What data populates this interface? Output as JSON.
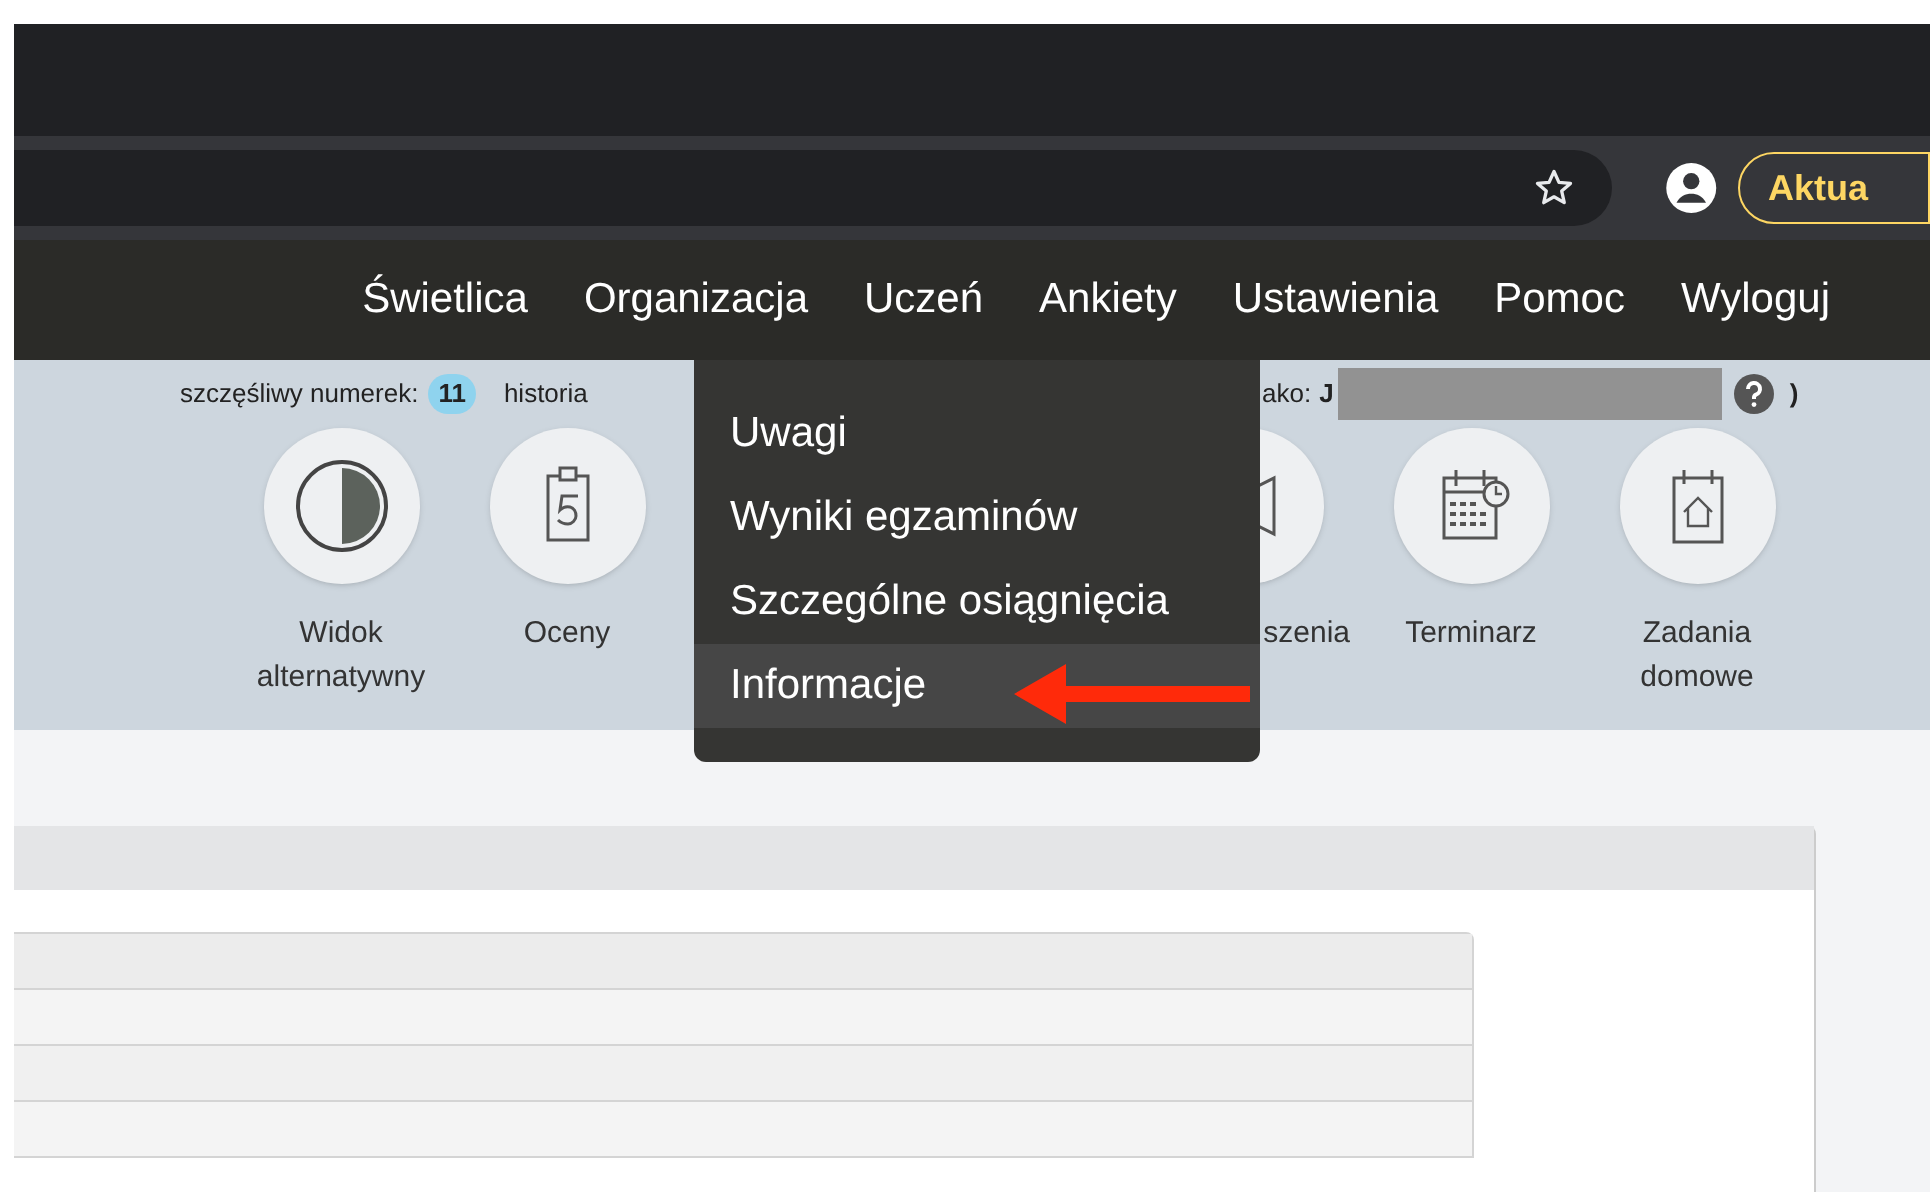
{
  "browser": {
    "profile_button": "Aktua"
  },
  "nav": {
    "items": [
      "Świetlica",
      "Organizacja",
      "Uczeń",
      "Ankiety",
      "Ustawienia",
      "Pomoc",
      "Wyloguj"
    ]
  },
  "info_bar": {
    "lucky_label": "szczęśliwy numerek:",
    "lucky_number": "11",
    "login_history": "historia",
    "logged_as": "ako:",
    "user": "J",
    "close_paren": ")"
  },
  "tiles": [
    {
      "kind": "contrast",
      "label": "Widok alternatywny"
    },
    {
      "kind": "grade",
      "label": "Oceny"
    },
    {
      "kind": "covered"
    },
    {
      "kind": "covered"
    },
    {
      "kind": "announcements",
      "label": "szenia",
      "cut": true
    },
    {
      "kind": "calendar",
      "label": "Terminarz"
    },
    {
      "kind": "homework",
      "label": "Zadania domowe"
    }
  ],
  "dropdown": {
    "items": [
      {
        "label": "Uwagi",
        "selected": false
      },
      {
        "label": "Wyniki egzaminów",
        "selected": false
      },
      {
        "label": "Szczególne osiągnięcia",
        "selected": false
      },
      {
        "label": "Informacje",
        "selected": true
      }
    ]
  }
}
